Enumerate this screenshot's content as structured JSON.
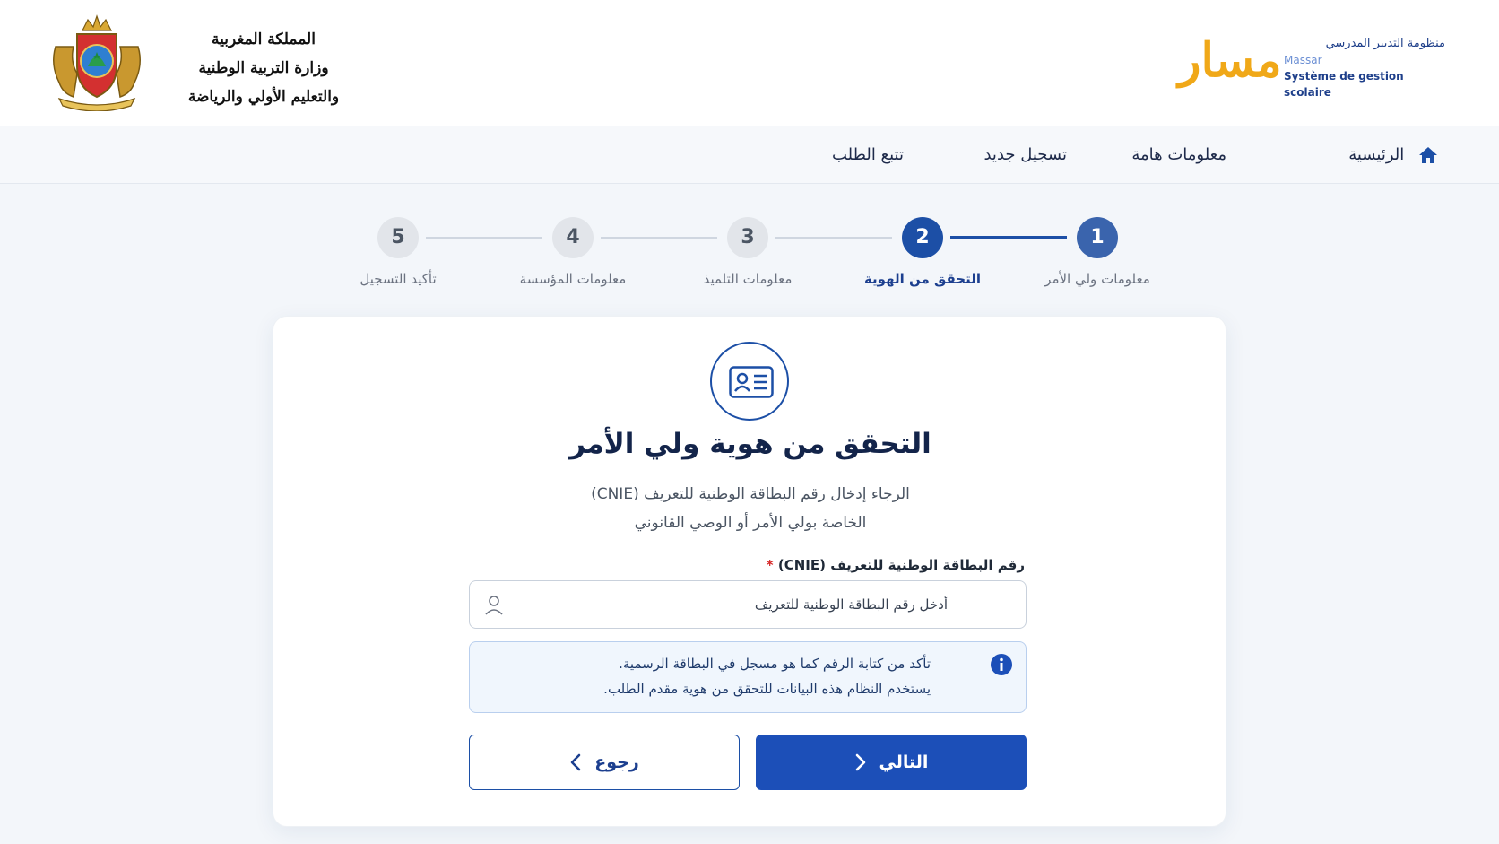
{
  "header": {
    "ministry_lines": [
      "المملكة المغربية",
      "وزارة التربية الوطنية",
      "والتعليم الأولي والرياضة"
    ],
    "massar": {
      "word": "مسار",
      "subtitle_ar": "منظومة التدبير المدرسي",
      "subtitle_latin": "Massar",
      "subtitle_fr": "Système de gestion scolaire"
    }
  },
  "nav": {
    "home": "الرئيسية",
    "info": "معلومات هامة",
    "register": "تسجيل جديد",
    "track": "تتبع الطلب"
  },
  "stepper": {
    "steps": [
      {
        "number": "1",
        "label": "معلومات ولي الأمر",
        "state": "done"
      },
      {
        "number": "2",
        "label": "التحقق من الهوية",
        "state": "active"
      },
      {
        "number": "3",
        "label": "معلومات التلميذ",
        "state": "pending"
      },
      {
        "number": "4",
        "label": "معلومات المؤسسة",
        "state": "pending"
      },
      {
        "number": "5",
        "label": "تأكيد التسجيل",
        "state": "pending"
      }
    ]
  },
  "card": {
    "title": "التحقق من هوية ولي الأمر",
    "subtitle_line1": "الرجاء إدخال رقم البطاقة الوطنية للتعريف (CNIE)",
    "subtitle_line2": "الخاصة بولي الأمر أو الوصي القانوني",
    "field_label": "رقم البطاقة الوطنية للتعريف (CNIE)",
    "field_required": "*",
    "field_placeholder": "أدخل رقم البطاقة الوطنية للتعريف",
    "field_value": "",
    "info_line1": "تأكد من كتابة الرقم كما هو مسجل في البطاقة الرسمية.",
    "info_line2": "يستخدم النظام هذه البيانات للتحقق من هوية مقدم الطلب.",
    "next_label": "التالي",
    "back_label": "رجوع"
  },
  "colors": {
    "primary": "#1c4fb8",
    "accent": "#f0a818",
    "step_pending": "#e2e5ea"
  }
}
